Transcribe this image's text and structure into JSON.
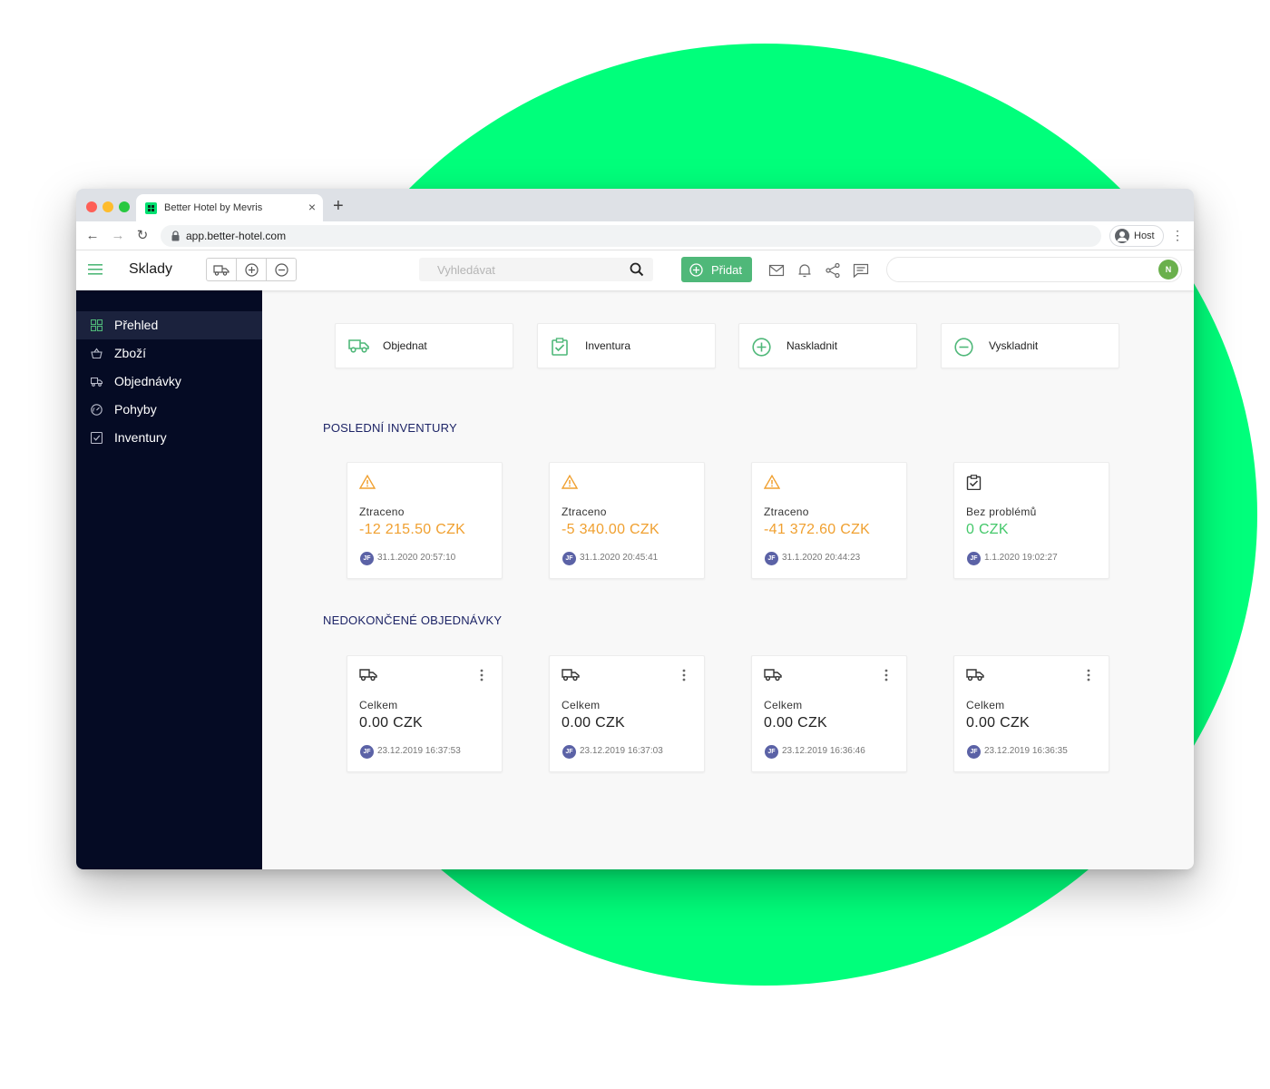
{
  "colors": {
    "brand_green": "#00ff7b",
    "accent_green": "#4fb879",
    "sidebar_bg": "#050b24",
    "loss_orange": "#f0a030",
    "ok_green": "#44c86a",
    "section_title": "#1d2466"
  },
  "browser": {
    "tab_title": "Better Hotel by Mevris",
    "url": "app.better-hotel.com",
    "profile_label": "Host"
  },
  "header": {
    "title": "Sklady",
    "search_placeholder": "Vyhledávat",
    "add_label": "Přidat",
    "user_initial": "N"
  },
  "sidebar": {
    "items": [
      {
        "label": "Přehled",
        "icon": "grid-icon",
        "active": true
      },
      {
        "label": "Zboží",
        "icon": "basket-icon"
      },
      {
        "label": "Objednávky",
        "icon": "truck-icon"
      },
      {
        "label": "Pohyby",
        "icon": "gauge-icon"
      },
      {
        "label": "Inventury",
        "icon": "checkbox-icon"
      }
    ]
  },
  "actions": [
    {
      "label": "Objednat",
      "icon": "truck-icon"
    },
    {
      "label": "Inventura",
      "icon": "clipboard-check-icon"
    },
    {
      "label": "Naskladnit",
      "icon": "plus-circle-icon"
    },
    {
      "label": "Vyskladnit",
      "icon": "minus-circle-icon"
    }
  ],
  "inventories": {
    "title": "POSLEDNÍ INVENTURY",
    "cards": [
      {
        "caption": "Ztraceno",
        "value": "-12 215.50 CZK",
        "initials": "JF",
        "date": "31.1.2020 20:57:10",
        "status": "warning"
      },
      {
        "caption": "Ztraceno",
        "value": "-5 340.00 CZK",
        "initials": "JF",
        "date": "31.1.2020 20:45:41",
        "status": "warning"
      },
      {
        "caption": "Ztraceno",
        "value": "-41 372.60 CZK",
        "initials": "JF",
        "date": "31.1.2020 20:44:23",
        "status": "warning"
      },
      {
        "caption": "Bez problémů",
        "value": "0 CZK",
        "initials": "JF",
        "date": "1.1.2020 19:02:27",
        "status": "ok"
      }
    ]
  },
  "orders": {
    "title": "NEDOKONČENÉ OBJEDNÁVKY",
    "cards": [
      {
        "caption": "Celkem",
        "value": "0.00 CZK",
        "initials": "JF",
        "date": "23.12.2019 16:37:53"
      },
      {
        "caption": "Celkem",
        "value": "0.00 CZK",
        "initials": "JF",
        "date": "23.12.2019 16:37:03"
      },
      {
        "caption": "Celkem",
        "value": "0.00 CZK",
        "initials": "JF",
        "date": "23.12.2019 16:36:46"
      },
      {
        "caption": "Celkem",
        "value": "0.00 CZK",
        "initials": "JF",
        "date": "23.12.2019 16:36:35"
      }
    ]
  }
}
